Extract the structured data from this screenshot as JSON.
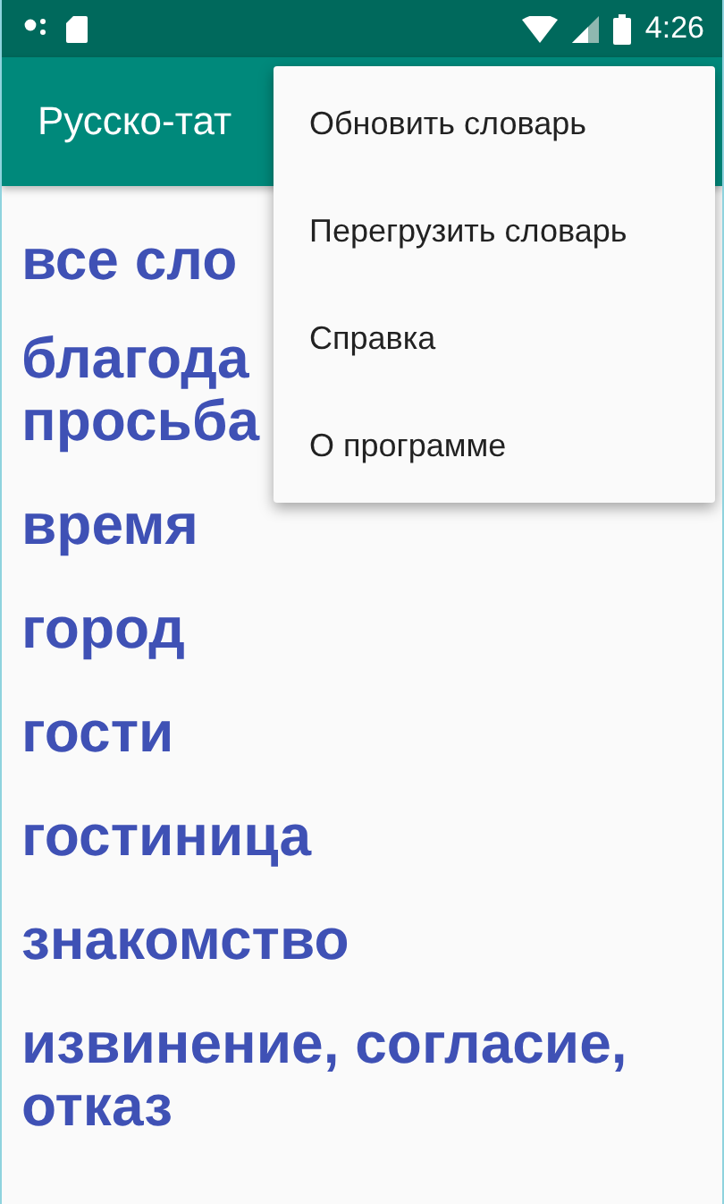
{
  "status_bar": {
    "time": "4:26"
  },
  "app_bar": {
    "title": "Русско-тат"
  },
  "word_list": [
    {
      "text": "все сло"
    },
    {
      "text": "благода\nпросьба"
    },
    {
      "text": "время"
    },
    {
      "text": "город"
    },
    {
      "text": "гости"
    },
    {
      "text": "гостиница"
    },
    {
      "text": "знакомство"
    },
    {
      "text": "извинение, согласие, отказ"
    }
  ],
  "overflow_menu": {
    "items": [
      {
        "label": "Обновить словарь"
      },
      {
        "label": "Перегрузить словарь"
      },
      {
        "label": "Справка"
      },
      {
        "label": "О программе"
      }
    ]
  }
}
